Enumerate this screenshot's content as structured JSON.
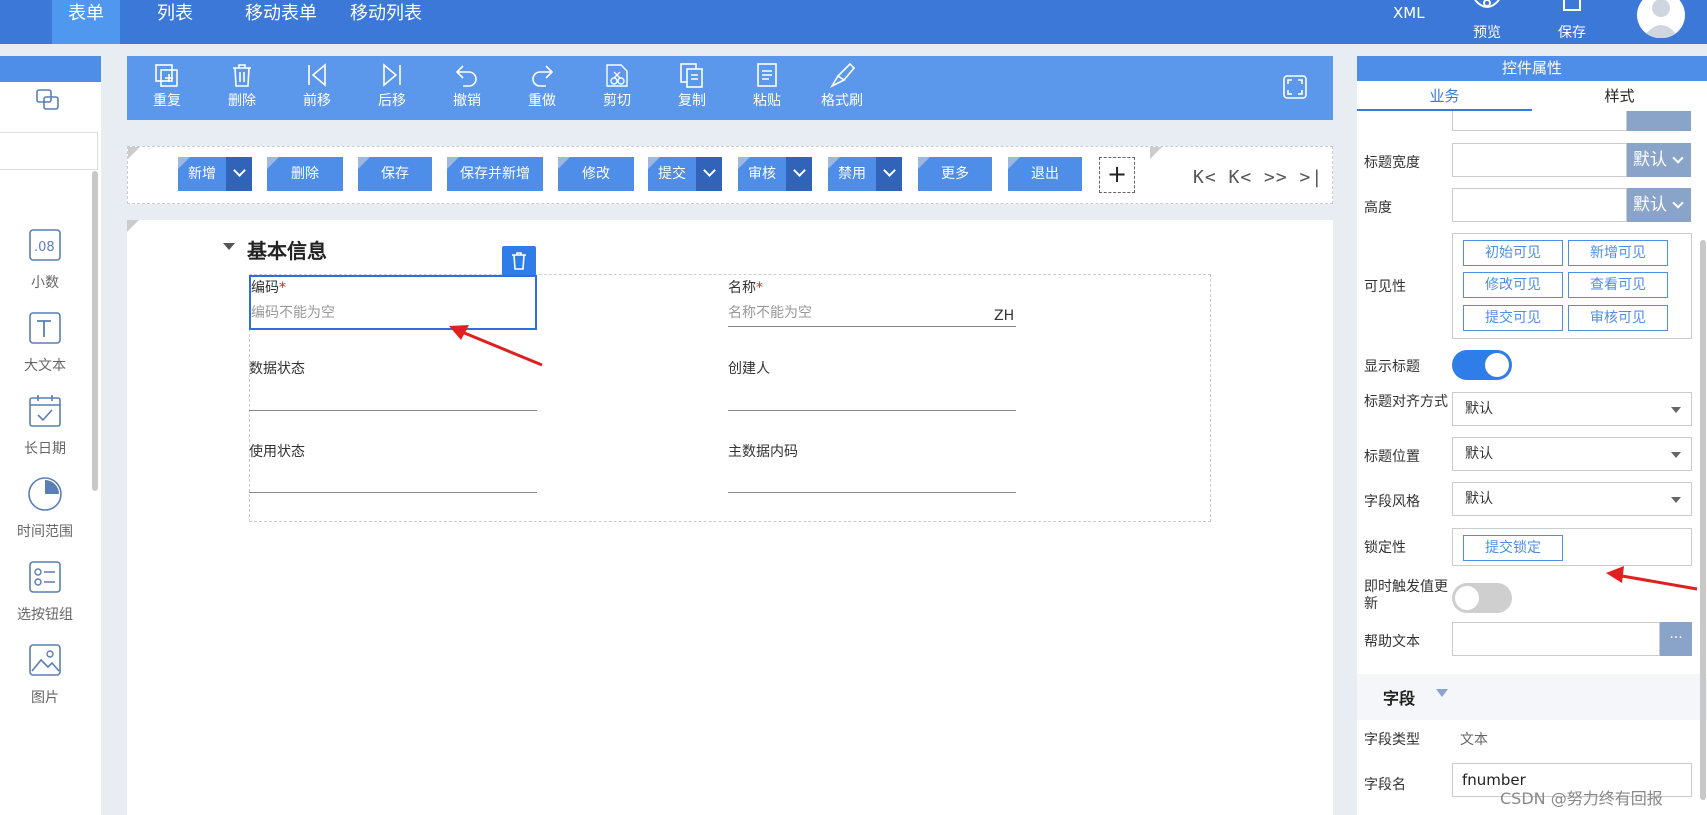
{
  "topbar": {
    "tabs": [
      "表单",
      "列表",
      "移动表单",
      "移动列表"
    ],
    "xml_label": "XML",
    "preview_label": "预览",
    "save_label": "保存"
  },
  "toolbar": {
    "items": [
      "重复",
      "删除",
      "前移",
      "后移",
      "撤销",
      "重做",
      "剪切",
      "复制",
      "粘贴",
      "格式刷"
    ]
  },
  "leftpanel": {
    "components": [
      {
        "label": "小数",
        "icon": "decimal-icon"
      },
      {
        "label": "大文本",
        "icon": "text-icon"
      },
      {
        "label": "长日期",
        "icon": "calendar-icon"
      },
      {
        "label": "时间范围",
        "icon": "pie-icon"
      },
      {
        "label": "选按钮组",
        "icon": "checkbox-group-icon"
      },
      {
        "label": "图片",
        "icon": "image-icon"
      }
    ]
  },
  "actions": {
    "buttons": [
      {
        "label": "新增",
        "dropdown": true
      },
      {
        "label": "删除",
        "dropdown": false
      },
      {
        "label": "保存",
        "dropdown": false
      },
      {
        "label": "保存并新增",
        "dropdown": false
      },
      {
        "label": "修改",
        "dropdown": false
      },
      {
        "label": "提交",
        "dropdown": true
      },
      {
        "label": "审核",
        "dropdown": true
      },
      {
        "label": "禁用",
        "dropdown": true
      },
      {
        "label": "更多",
        "dropdown": false
      },
      {
        "label": "退出",
        "dropdown": false
      }
    ],
    "add": "+",
    "pager": "K< K< >> >|"
  },
  "form": {
    "section_title": "基本信息",
    "required_mark": "*",
    "fields": {
      "code_label": "编码",
      "code_placeholder": "编码不能为空",
      "name_label": "名称",
      "name_placeholder": "名称不能为空",
      "name_suffix": "ZH",
      "data_status_label": "数据状态",
      "creator_label": "创建人",
      "use_status_label": "使用状态",
      "master_code_label": "主数据内码"
    }
  },
  "props": {
    "title": "控件属性",
    "tab_business": "业务",
    "tab_style": "样式",
    "default_label": "默认",
    "title_width_label": "标题宽度",
    "height_label": "高度",
    "visibility_label": "可见性",
    "visibility_buttons": [
      "初始可见",
      "新增可见",
      "修改可见",
      "查看可见",
      "提交可见",
      "审核可见"
    ],
    "show_title_label": "显示标题",
    "show_title_on": true,
    "title_align_label": "标题对齐方式",
    "title_align_value": "默认",
    "title_position_label": "标题位置",
    "title_position_value": "默认",
    "field_style_label": "字段风格",
    "field_style_value": "默认",
    "lock_label": "锁定性",
    "lock_button": "提交锁定",
    "instant_trigger_label": "即时触发值更新",
    "instant_trigger_on": false,
    "help_text_label": "帮助文本",
    "help_more": "···",
    "field_section_title": "字段",
    "field_type_label": "字段类型",
    "field_type_value": "文本",
    "field_name_label": "字段名",
    "field_name_value": "fnumber"
  },
  "watermark": "CSDN @努力终有回报",
  "colors": {
    "topbar": "#3b78d8",
    "toolbar": "#5b97ea",
    "accent": "#4f8ee8",
    "arrow": "#e02020"
  }
}
